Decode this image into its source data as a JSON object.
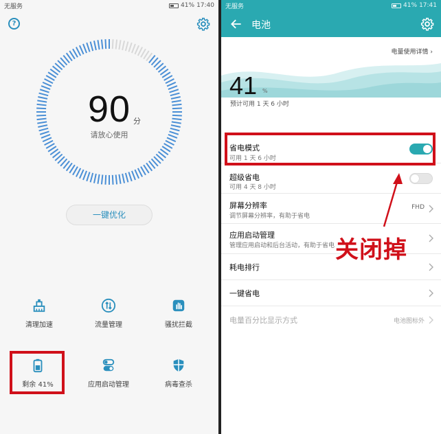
{
  "left": {
    "status_left": "无服务",
    "status_right": "41%",
    "status_time": "17:40",
    "help_glyph": "?",
    "score": "90",
    "score_unit": "分",
    "score_sub": "请放心使用",
    "optimize_label": "一键优化",
    "tools": [
      {
        "label": "清理加速"
      },
      {
        "label": "流量管理"
      },
      {
        "label": "骚扰拦截"
      },
      {
        "label": "剩余 41%"
      },
      {
        "label": "应用启动管理"
      },
      {
        "label": "病毒查杀"
      }
    ]
  },
  "right": {
    "status_left": "无服务",
    "status_right": "41%",
    "status_time": "17:41",
    "title": "电池",
    "usage_link": "电量使用详情",
    "battery_percent": "41",
    "battery_percent_unit": "%",
    "battery_estimate": "预计可用 1 天 6 小时",
    "rows": {
      "power_saving": {
        "title": "省电模式",
        "sub": "可用 1 天 6 小时",
        "on": true
      },
      "ultra_saving": {
        "title": "超级省电",
        "sub": "可用 4 天 8 小时",
        "on": false
      },
      "resolution": {
        "title": "屏幕分辨率",
        "sub": "调节屏幕分辨率，有助于省电",
        "value": "FHD"
      },
      "startup": {
        "title": "应用启动管理",
        "sub": "管理应用启动和后台活动，有助于省电"
      },
      "ranking": {
        "title": "耗电排行"
      },
      "one_key": {
        "title": "一键省电"
      },
      "percent_display": {
        "title": "电量百分比显示方式",
        "value": "电池图标外"
      }
    },
    "annotation": "关闭掉"
  },
  "colors": {
    "accent": "#2aa9b1",
    "left_accent": "#2a8fbd",
    "annotation_red": "#d0101a"
  }
}
